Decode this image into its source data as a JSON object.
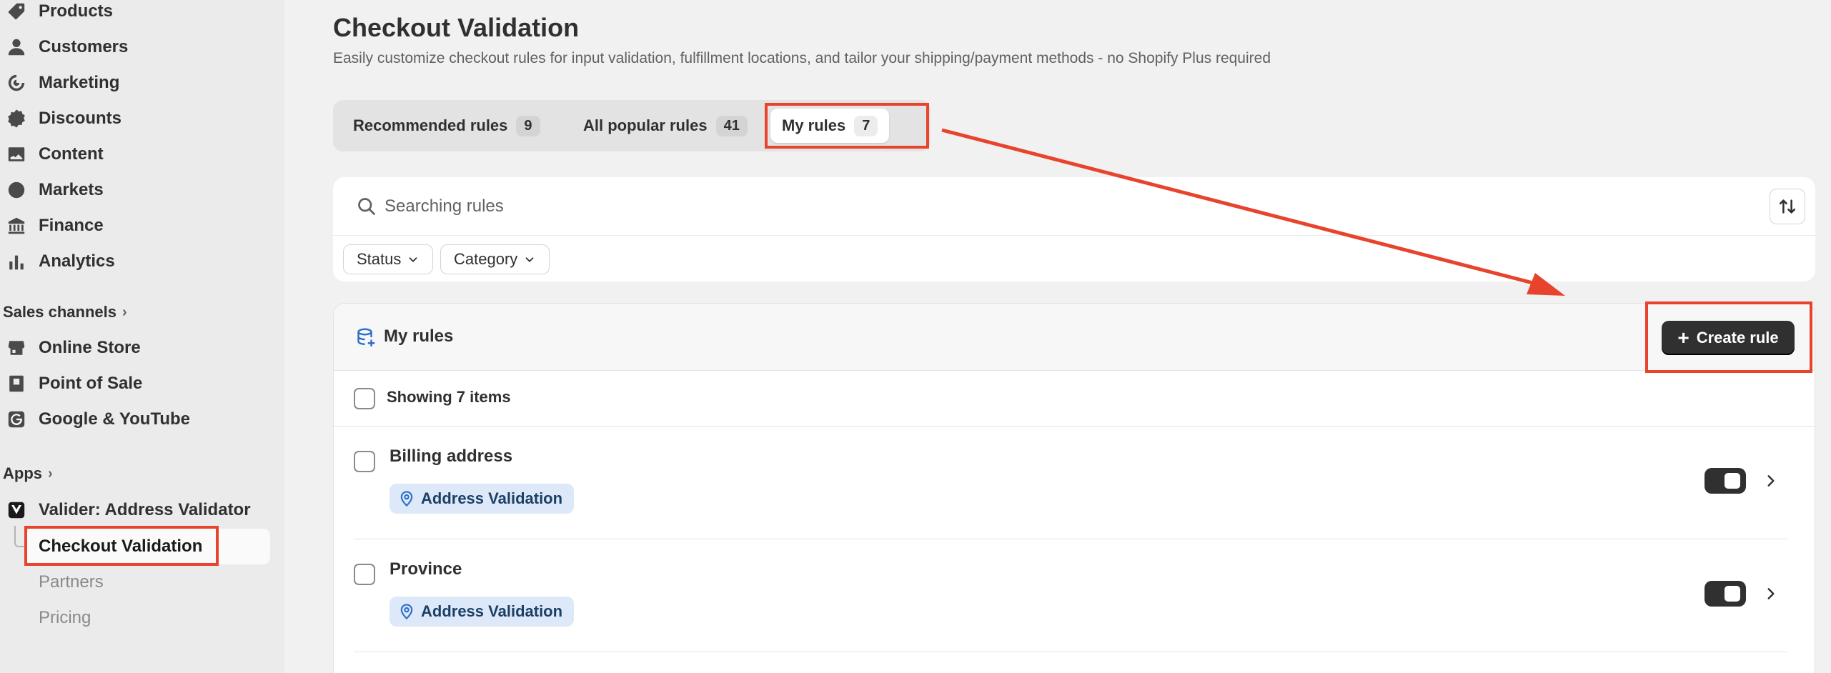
{
  "sidebar": {
    "nav": [
      {
        "label": "Products",
        "icon": "tag-icon"
      },
      {
        "label": "Customers",
        "icon": "person-icon"
      },
      {
        "label": "Marketing",
        "icon": "target-icon"
      },
      {
        "label": "Discounts",
        "icon": "discount-icon"
      },
      {
        "label": "Content",
        "icon": "image-icon"
      },
      {
        "label": "Markets",
        "icon": "globe-icon"
      },
      {
        "label": "Finance",
        "icon": "bank-icon"
      },
      {
        "label": "Analytics",
        "icon": "bar-chart-icon"
      }
    ],
    "sales_channels_label": "Sales channels",
    "channels": [
      {
        "label": "Online Store",
        "icon": "store-icon"
      },
      {
        "label": "Point of Sale",
        "icon": "pos-icon"
      },
      {
        "label": "Google & YouTube",
        "icon": "google-icon"
      }
    ],
    "apps_label": "Apps",
    "app_name": "Valider: Address Validator",
    "app_subitems": {
      "active": "Checkout Validation",
      "partners": "Partners",
      "pricing": "Pricing"
    }
  },
  "page": {
    "title": "Checkout Validation",
    "subtitle": "Easily customize checkout rules for input validation, fulfillment locations, and tailor your shipping/payment methods - no Shopify Plus required"
  },
  "tabs": [
    {
      "label": "Recommended rules",
      "count": "9"
    },
    {
      "label": "All popular rules",
      "count": "41"
    },
    {
      "label": "My rules",
      "count": "7",
      "active": true
    }
  ],
  "search": {
    "placeholder": "Searching rules",
    "value": ""
  },
  "filters": {
    "status": "Status",
    "category": "Category"
  },
  "rules_section": {
    "title": "My rules",
    "create_label": "Create rule",
    "showing": "Showing 7 items",
    "rows": [
      {
        "name": "Billing address",
        "badge": "Address Validation",
        "enabled": true
      },
      {
        "name": "Province",
        "badge": "Address Validation",
        "enabled": true
      }
    ]
  },
  "colors": {
    "highlight": "#e8432d",
    "primary_button": "#303030",
    "badge_bg": "#dde9f8"
  }
}
